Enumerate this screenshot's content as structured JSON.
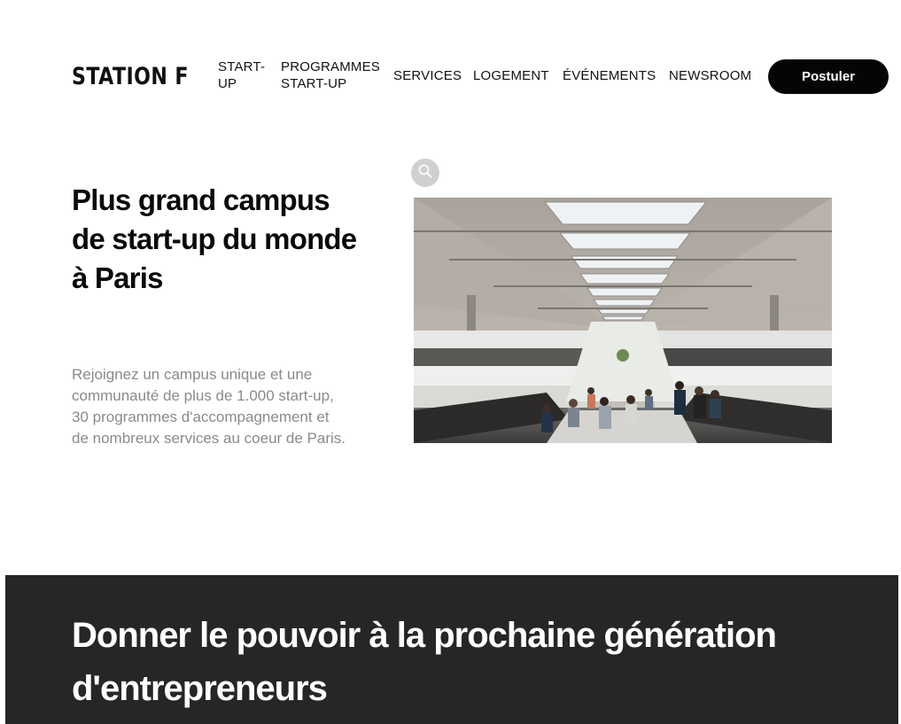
{
  "header": {
    "logo": "STATION F",
    "nav": [
      {
        "id": "start-up",
        "label": "START-\nUP"
      },
      {
        "id": "programmes",
        "label": "PROGRAMMES\nSTART-UP"
      },
      {
        "id": "services",
        "label": "SERVICES"
      },
      {
        "id": "logement",
        "label": "LOGEMENT"
      },
      {
        "id": "evenements",
        "label": "ÉVÉNEMENTS"
      },
      {
        "id": "newsroom",
        "label": "NEWSROOM"
      }
    ],
    "cta_label": "Postuler"
  },
  "hero": {
    "title": "Plus grand campus de start-up du monde à Paris",
    "text": "Rejoignez un campus unique et une communauté de plus de 1.000 start-up, 30 programmes d'accompagnement et de nombreux services au coeur de Paris.",
    "zoom_icon": "search-icon"
  },
  "mission": {
    "title": "Donner le pouvoir à la prochaine génération d'entrepreneurs"
  },
  "colors": {
    "button_bg": "#050505",
    "muted_text": "#8a8a8a",
    "dark_section_bg": "#262626"
  }
}
